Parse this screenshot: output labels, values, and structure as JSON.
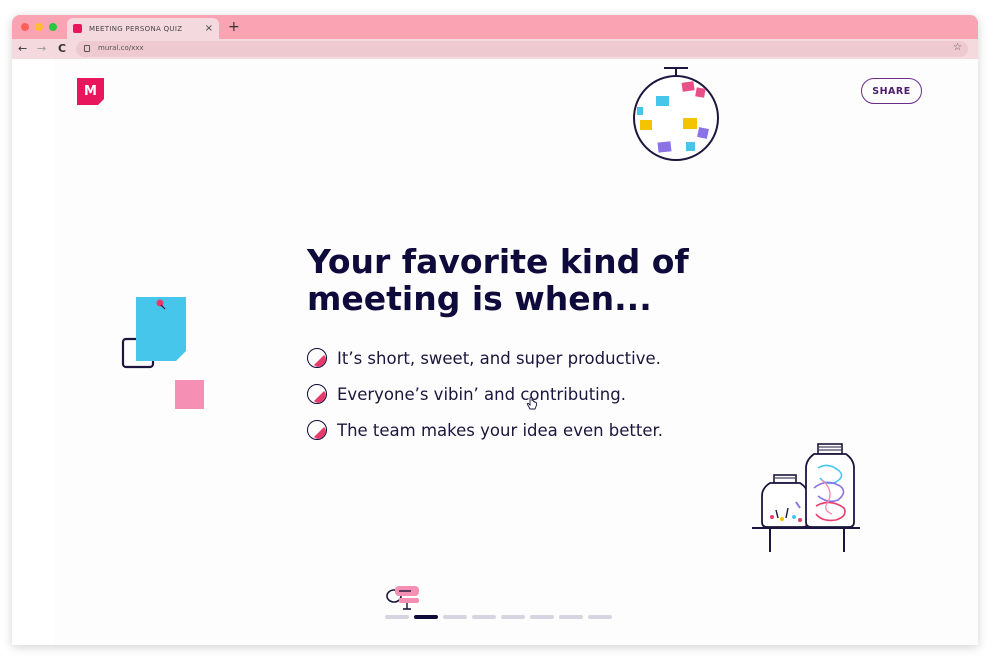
{
  "browser": {
    "tab_title": "MEETING PERSONA QUIZ",
    "tab_close": "×",
    "new_tab": "+",
    "url": "mural.co/xxx",
    "back": "←",
    "forward": "→",
    "reload": "C",
    "bookmark": "☆",
    "colors": {
      "tabbar": "#f9a3b3",
      "toolbar": "#f4dadf"
    }
  },
  "header": {
    "logo_letter": "M",
    "share_label": "SHARE"
  },
  "question": {
    "title": "Your favorite kind of meeting is when...",
    "options": [
      {
        "label": "It’s short, sweet, and super productive."
      },
      {
        "label": "Everyone’s vibin’ and contributing."
      },
      {
        "label": "The team makes your idea even better."
      }
    ]
  },
  "progress": {
    "current": 2,
    "total": 8
  },
  "colors": {
    "accent": "#e8175d",
    "navy": "#0e0a3b",
    "purple": "#6b2c8c",
    "option_fill": "#e63c6b"
  }
}
